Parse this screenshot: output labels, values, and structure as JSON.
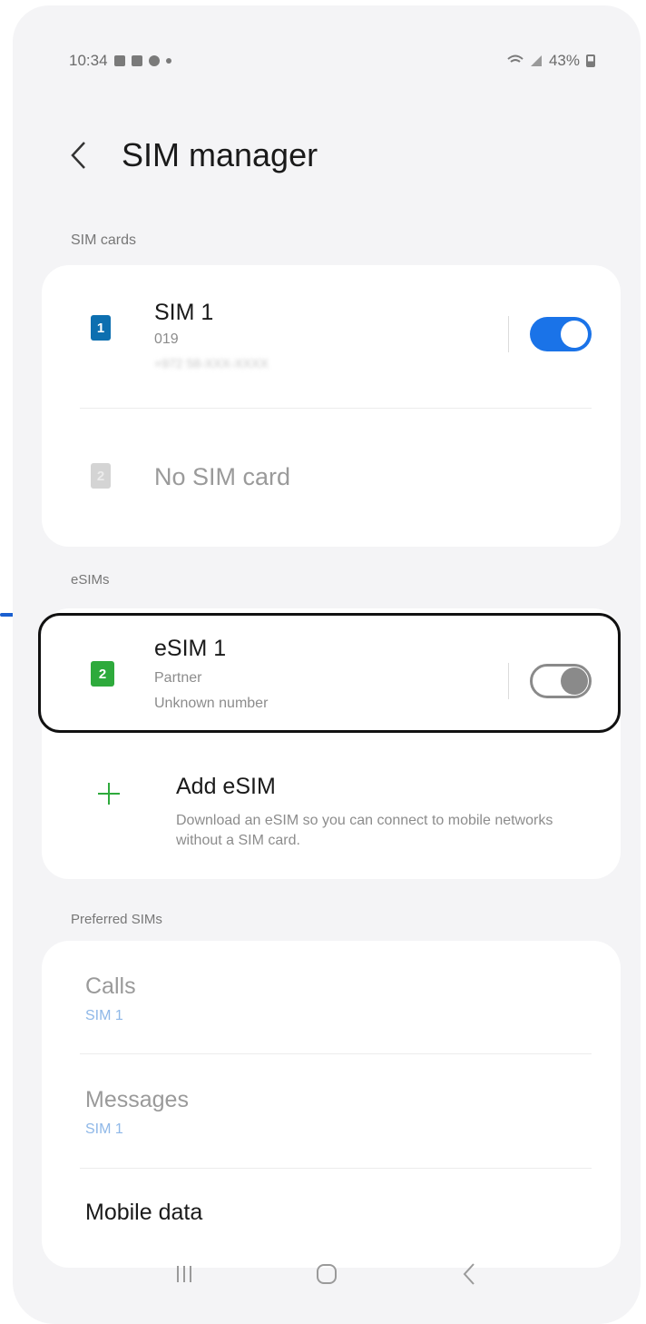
{
  "status_bar": {
    "time": "10:34",
    "battery": "43%"
  },
  "header": {
    "title": "SIM manager"
  },
  "sim_cards": {
    "label": "SIM cards",
    "sim1": {
      "badge": "1",
      "title": "SIM 1",
      "number": "019",
      "subtitle_blurred": "+972 58-XXX-XXXX",
      "enabled": true
    },
    "sim2": {
      "badge": "2",
      "title": "No SIM card"
    }
  },
  "esims": {
    "label": "eSIMs",
    "esim1": {
      "badge": "2",
      "title": "eSIM 1",
      "carrier": "Partner",
      "number": "Unknown number",
      "enabled": false
    },
    "add": {
      "title": "Add eSIM",
      "description": "Download an eSIM so you can connect to mobile networks without a SIM card."
    }
  },
  "preferred": {
    "label": "Preferred SIMs",
    "calls": {
      "title": "Calls",
      "value": "SIM 1"
    },
    "messages": {
      "title": "Messages",
      "value": "SIM 1"
    },
    "mobile_data": {
      "title": "Mobile data"
    }
  },
  "colors": {
    "accent": "#1a73e8",
    "sim1": "#0d6fb0",
    "esim": "#2eaa3c",
    "highlight": "#111111",
    "arrow": "#1a5fd0"
  },
  "icons": [
    "back-chevron-icon",
    "sim-card-icon",
    "plus-icon",
    "recents-icon",
    "home-icon",
    "back-icon",
    "arrow-icon"
  ]
}
